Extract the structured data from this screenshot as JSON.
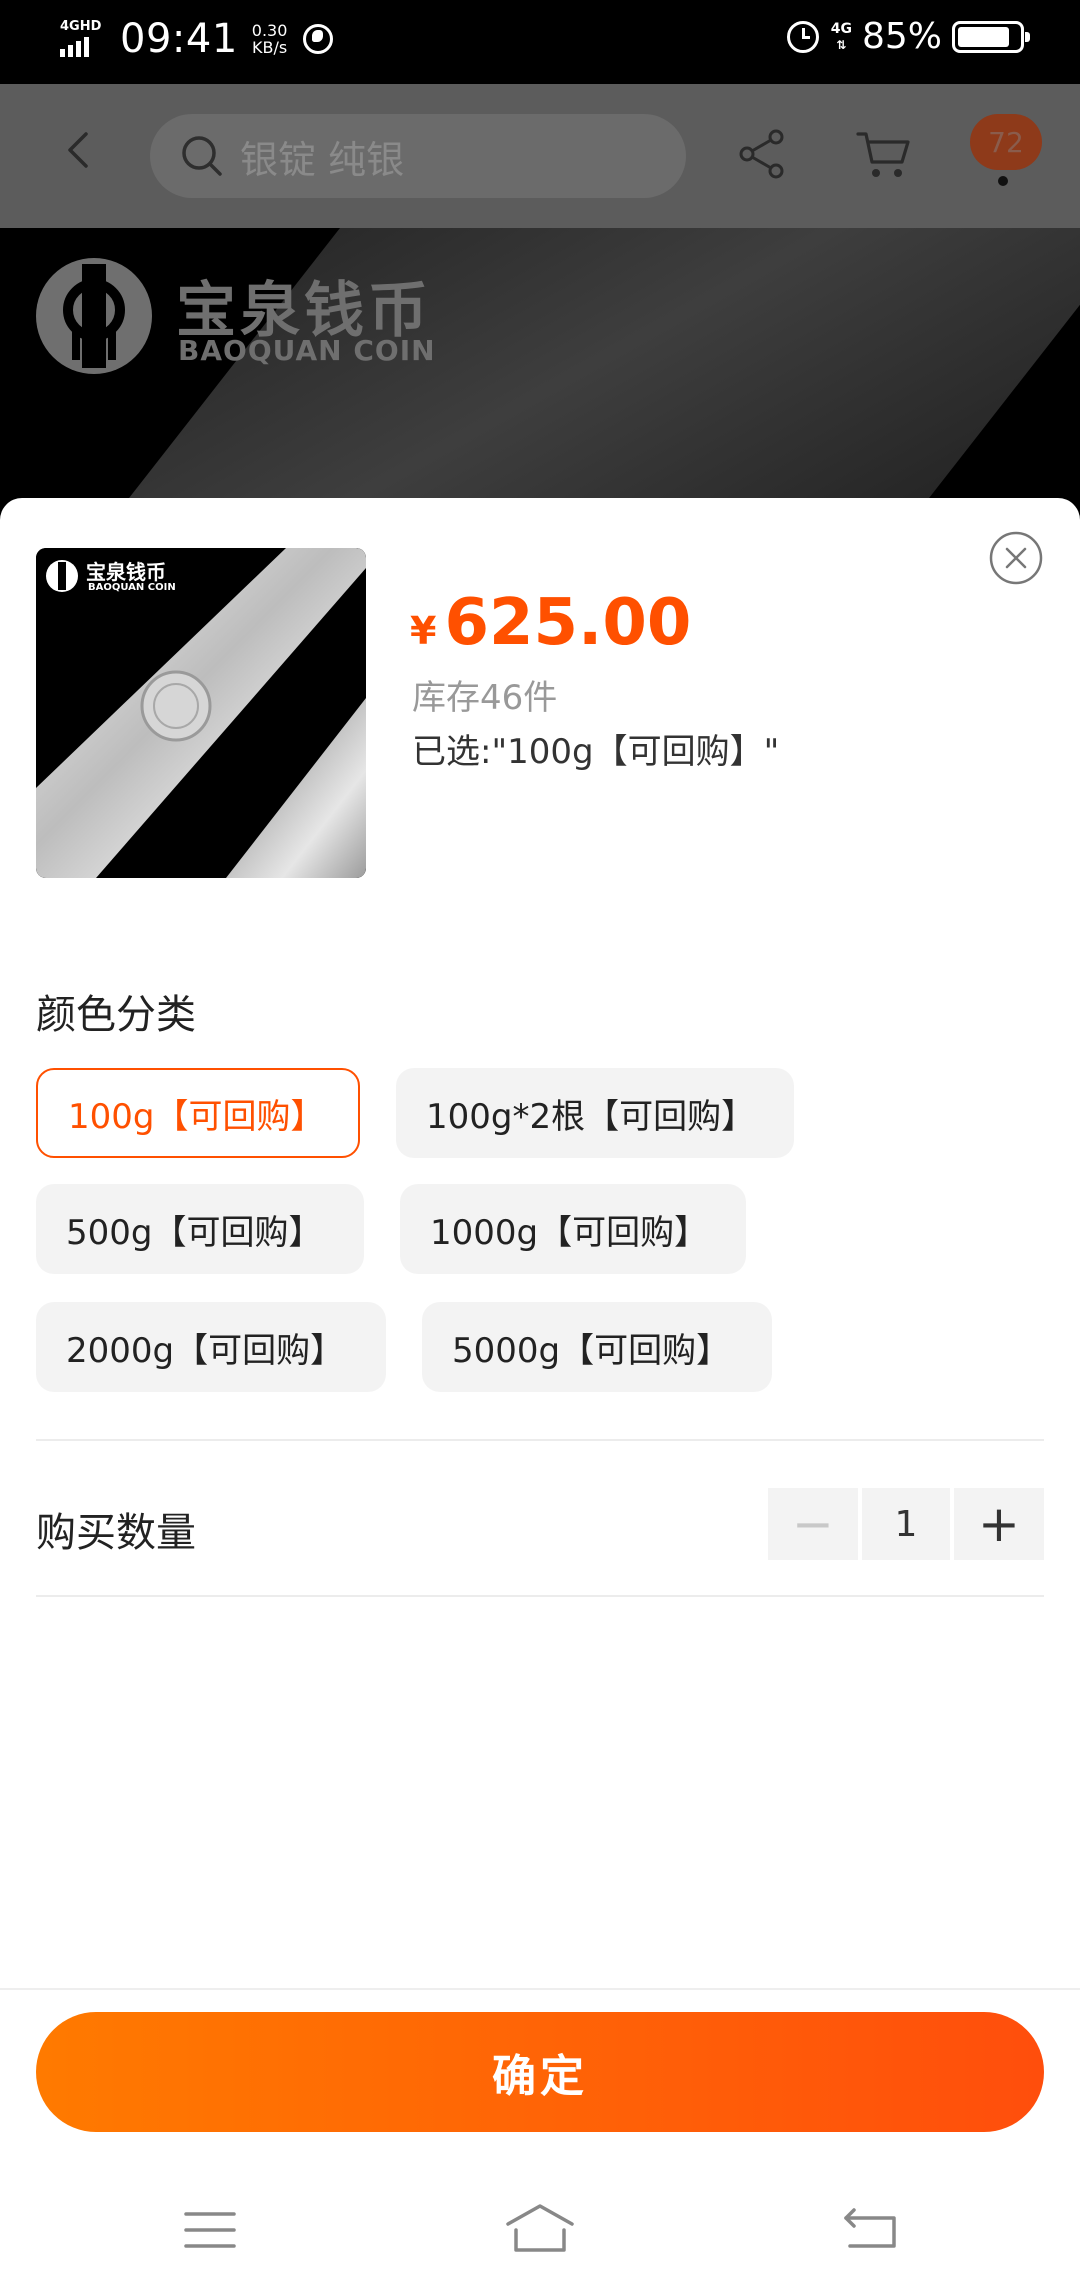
{
  "status_bar": {
    "network": "4GHD",
    "time": "09:41",
    "speed_value": "0.30",
    "speed_unit": "KB/s",
    "network_right": "4G",
    "battery_percent": "85%",
    "battery_level": 0.85
  },
  "header": {
    "search_placeholder": "银锭 纯银",
    "message_count": "72"
  },
  "banner": {
    "brand_cn": "宝泉钱币",
    "brand_en": "BAOQUAN COIN"
  },
  "product": {
    "thumb_brand_cn": "宝泉钱币",
    "thumb_brand_en": "BAOQUAN COIN",
    "currency": "¥",
    "price": "625.00",
    "stock": "库存46件",
    "selected": "已选:\"100g【可回购】\""
  },
  "options": {
    "title": "颜色分类",
    "items": [
      {
        "label": "100g【可回购】",
        "selected": true
      },
      {
        "label": "100g*2根【可回购】",
        "selected": false
      },
      {
        "label": "500g【可回购】",
        "selected": false
      },
      {
        "label": "1000g【可回购】",
        "selected": false
      },
      {
        "label": "2000g【可回购】",
        "selected": false
      },
      {
        "label": "5000g【可回购】",
        "selected": false
      }
    ]
  },
  "quantity": {
    "label": "购买数量",
    "value": "1",
    "minus": "−",
    "plus": "+"
  },
  "confirm_label": "确定",
  "colors": {
    "accent": "#ff5000",
    "button_gradient_start": "#ff7a00",
    "button_gradient_end": "#ff4e0c"
  },
  "icons": [
    "back-icon",
    "search-icon",
    "share-icon",
    "cart-icon",
    "close-icon",
    "menu-icon",
    "home-icon",
    "back-nav-icon"
  ]
}
